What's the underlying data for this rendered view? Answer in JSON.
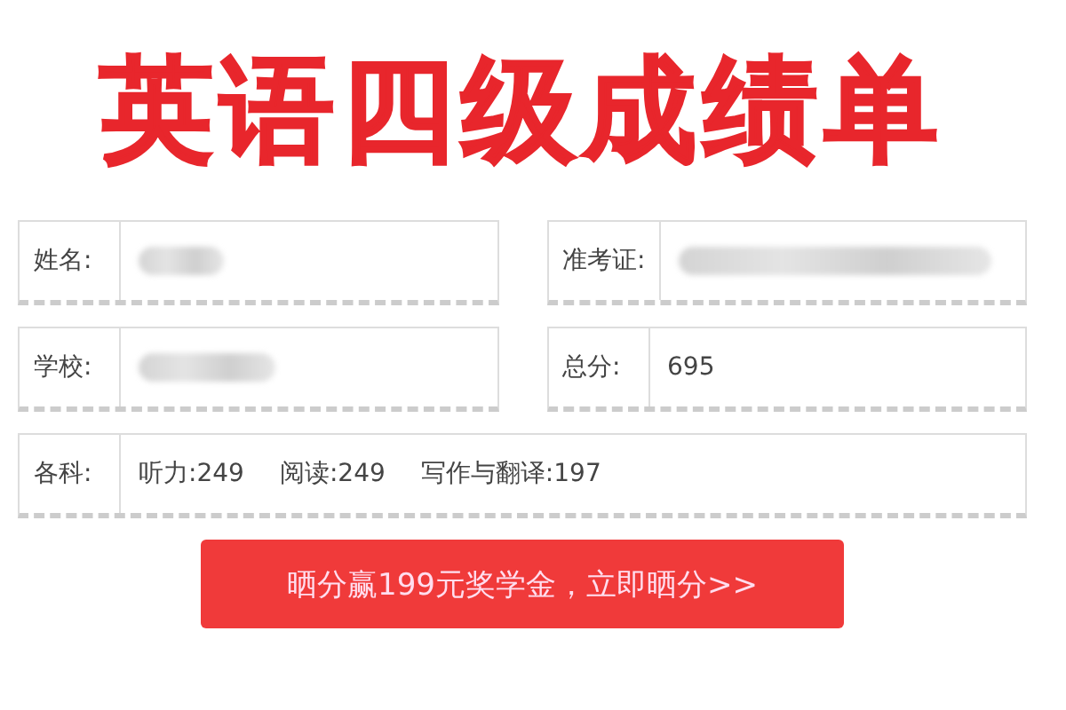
{
  "title": "英语四级成绩单",
  "rows": [
    [
      {
        "label": "姓名:",
        "kind": "redacted"
      },
      {
        "label": "准考证:",
        "kind": "redacted"
      }
    ],
    [
      {
        "label": "学校:",
        "kind": "redacted"
      },
      {
        "label": "总分:",
        "kind": "text",
        "value": "695"
      }
    ],
    [
      {
        "label": "各科:",
        "kind": "scores",
        "scores": [
          "听力:249",
          "阅读:249",
          "写作与翻译:197"
        ]
      }
    ]
  ],
  "button": "晒分赢199元奖学金，立即晒分>>"
}
